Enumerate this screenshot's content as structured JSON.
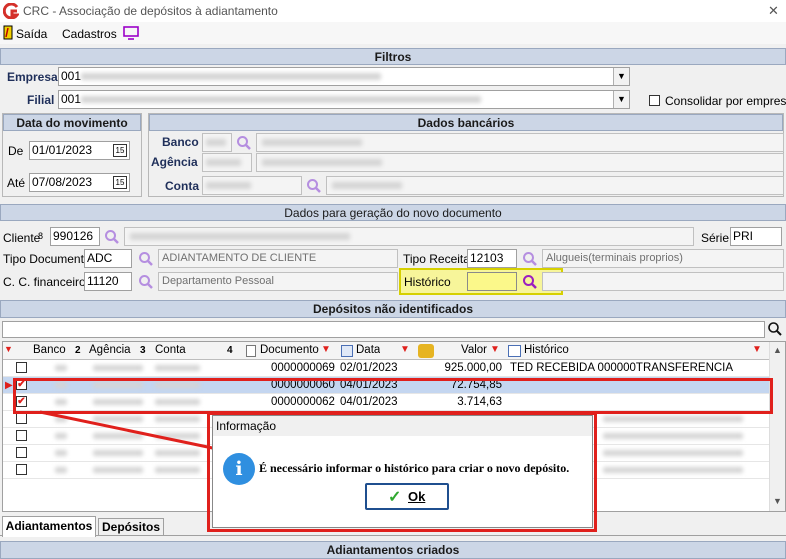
{
  "window": {
    "title": "CRC - Associação de depósitos à adiantamento",
    "close": "✕"
  },
  "menu": {
    "saida": "Saída",
    "cadastros": "Cadastros"
  },
  "filtros": {
    "header": "Filtros",
    "empresa_label": "Empresa",
    "empresa_value": "001",
    "filial_label": "Filial",
    "filial_value": "001",
    "consolidar_label": "Consolidar por empresa"
  },
  "data_mov": {
    "header": "Data do movimento",
    "de_label": "De",
    "de_value": "01/01/2023",
    "ate_label": "Até",
    "ate_value": "07/08/2023",
    "cal": "15"
  },
  "dados_bancarios": {
    "header": "Dados bancários",
    "banco": "Banco",
    "agencia": "Agência",
    "conta": "Conta"
  },
  "novo_doc": {
    "header": "Dados para geração do novo documento",
    "cliente_label": "Cliente",
    "cliente_value": "990126",
    "serie_label": "Série",
    "serie_value": "PRI",
    "tipo_doc_label": "Tipo Documento",
    "tipo_doc_value": "ADC",
    "tipo_doc_desc": "ADIANTAMENTO DE CLIENTE",
    "tipo_receita_label": "Tipo Receita",
    "tipo_receita_value": "12103",
    "tipo_receita_desc": "Alugueis(terminais proprios)",
    "cc_label": "C. C. financeiro",
    "cc_value": "11120",
    "cc_desc": "Departamento Pessoal",
    "historico_label": "Histórico",
    "historico_value": ""
  },
  "depositos": {
    "header": "Depósitos não identificados",
    "columns": {
      "banco": "Banco",
      "banco_n": "2",
      "agencia": "Agência",
      "agencia_n": "3",
      "conta": "Conta",
      "conta_n": "4",
      "documento": "Documento",
      "data": "Data",
      "valor": "Valor",
      "historico": "Histórico"
    },
    "rows": [
      {
        "documento": "0000000069",
        "data": "02/01/2023",
        "valor": "925.000,00",
        "historico": "TED RECEBIDA  000000TRANSFERENCIA",
        "checked": false
      },
      {
        "documento": "0000000060",
        "data": "04/01/2023",
        "valor": "72.754,85",
        "historico": "",
        "checked": true
      },
      {
        "documento": "0000000062",
        "data": "04/01/2023",
        "valor": "3.714,63",
        "historico": "",
        "checked": true
      },
      {
        "documento": "",
        "data": "",
        "valor": "",
        "historico": "",
        "checked": false
      },
      {
        "documento": "",
        "data": "",
        "valor": "",
        "historico": "",
        "checked": false
      },
      {
        "documento": "",
        "data": "",
        "valor": "",
        "historico": "",
        "checked": false
      },
      {
        "documento": "",
        "data": "",
        "valor": "",
        "historico": "",
        "checked": false
      }
    ]
  },
  "tabs": [
    "Adiantamentos",
    "Depósitos"
  ],
  "bottom_header": "Adiantamentos criados",
  "dialog": {
    "title": "Informação",
    "message": "É necessário informar o histórico para criar o novo depósito.",
    "ok": "Ok",
    "icon": "i"
  },
  "colors": {
    "accent_red": "#e0201c",
    "header_bg": "#ccd6e6",
    "selected_row": "#c4d6f0",
    "highlight_yellow": "#f7f59a",
    "info_blue": "#2f8fe0"
  }
}
